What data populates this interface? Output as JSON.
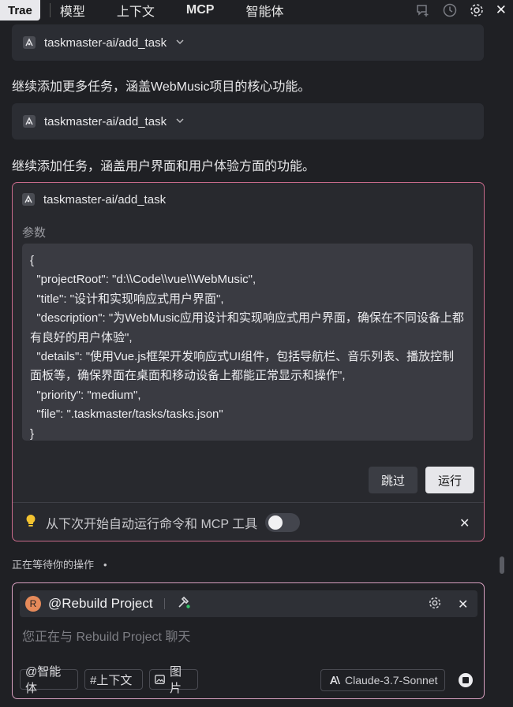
{
  "topbar": {
    "brand": "Trae",
    "tabs": [
      "模型",
      "上下文",
      "MCP",
      "智能体"
    ],
    "icons": [
      "new-chat-icon",
      "history-icon",
      "gear-icon",
      "close-icon"
    ]
  },
  "cards": [
    {
      "tool": "taskmaster-ai/add_task"
    },
    {
      "tool": "taskmaster-ai/add_task"
    }
  ],
  "messages": [
    "继续添加更多任务，涵盖WebMusic项目的核心功能。",
    "继续添加任务，涵盖用户界面和用户体验方面的功能。"
  ],
  "active_call": {
    "tool": "taskmaster-ai/add_task",
    "params_label": "参数",
    "params_code": "{\n  \"projectRoot\": \"d:\\\\Code\\\\vue\\\\WebMusic\",\n  \"title\": \"设计和实现响应式用户界面\",\n  \"description\": \"为WebMusic应用设计和实现响应式用户界面，确保在不同设备上都有良好的用户体验\",\n  \"details\": \"使用Vue.js框架开发响应式UI组件，包括导航栏、音乐列表、播放控制面板等，确保界面在桌面和移动设备上都能正常显示和操作\",\n  \"priority\": \"medium\",\n  \"file\": \".taskmaster/tasks/tasks.json\"\n}",
    "skip_label": "跳过",
    "run_label": "运行",
    "autorun_label": "从下次开始自动运行命令和 MCP 工具",
    "autorun_enabled": false
  },
  "status": {
    "waiting": "正在等待你的操作",
    "dot": "•"
  },
  "input": {
    "avatar_letter": "R",
    "agent_name": "@Rebuild Project",
    "placeholder": "您正在与 Rebuild Project 聊天",
    "chips": [
      "@智能体",
      "#上下文",
      "图片"
    ],
    "model": "Claude-3.7-Sonnet"
  }
}
